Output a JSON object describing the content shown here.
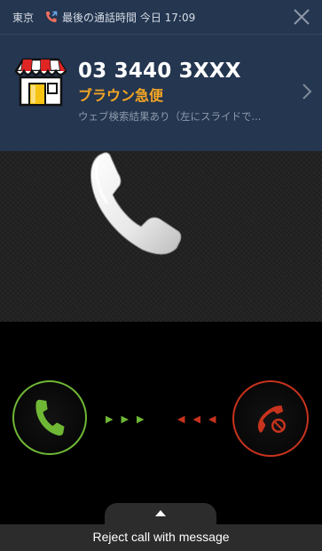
{
  "status": {
    "location": "東京",
    "last_call": "最後の通話時間 今日 17:09"
  },
  "caller": {
    "number": "03 3440 3XXX",
    "name": "ブラウン急便",
    "hint": "ウェブ検索結果あり（左にスライドで..."
  },
  "controls": {
    "reject_with_message": "Reject call with message"
  },
  "icons": {
    "call": "phone-call-icon",
    "close": "close-icon",
    "shop": "shop-icon",
    "chevron": "chevron-right-icon",
    "handset": "handset-icon",
    "answer": "answer-phone-icon",
    "reject": "reject-phone-icon",
    "up": "chevron-up-icon"
  },
  "colors": {
    "banner": "#243650",
    "name": "#f5a623",
    "answer": "#6fb836",
    "reject": "#c8331d"
  }
}
